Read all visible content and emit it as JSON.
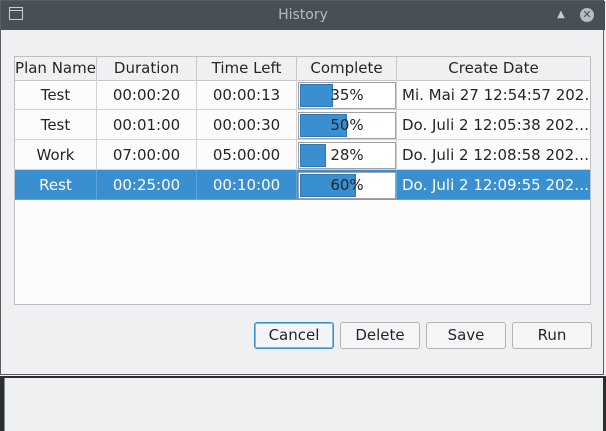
{
  "window": {
    "title": "History",
    "up_glyph": "▲",
    "close_glyph": "✕"
  },
  "table": {
    "columns": [
      "Plan Name",
      "Duration",
      "Time Left",
      "Complete",
      "Create Date"
    ],
    "rows": [
      {
        "name": "Test",
        "duration": "00:00:20",
        "left": "00:00:13",
        "complete": 35,
        "complete_label": "35%",
        "date": "Mi. Mai 27 12:54:57 202…",
        "selected": false
      },
      {
        "name": "Test",
        "duration": "00:01:00",
        "left": "00:00:30",
        "complete": 50,
        "complete_label": "50%",
        "date": "Do. Juli 2 12:05:38 202…",
        "selected": false
      },
      {
        "name": "Work",
        "duration": "07:00:00",
        "left": "05:00:00",
        "complete": 28,
        "complete_label": "28%",
        "date": "Do. Juli 2 12:08:58 202…",
        "selected": false
      },
      {
        "name": "Rest",
        "duration": "00:25:00",
        "left": "00:10:00",
        "complete": 60,
        "complete_label": "60%",
        "date": "Do. Juli 2 12:09:55 202…",
        "selected": true
      }
    ]
  },
  "buttons": {
    "cancel": "Cancel",
    "delete": "Delete",
    "save": "Save",
    "run": "Run"
  },
  "icons": {
    "app": "window-icon",
    "up": "keep-above-icon",
    "close": "close-icon"
  }
}
